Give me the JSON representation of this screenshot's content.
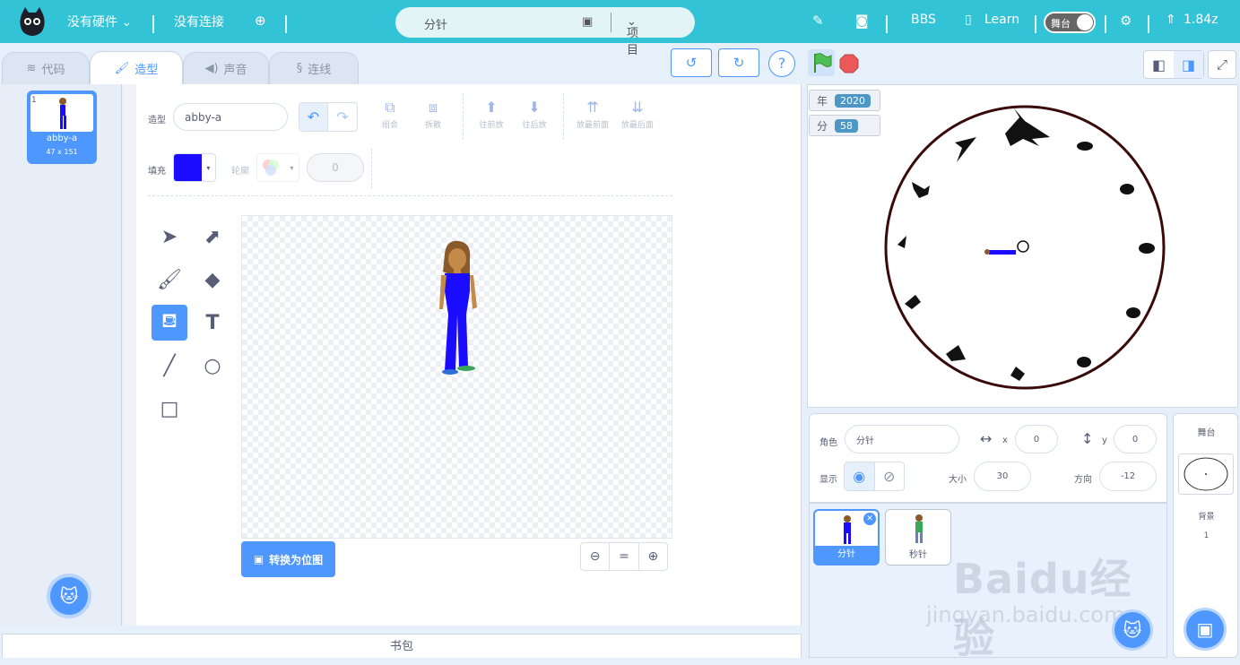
{
  "topbar": {
    "hardware": "没有硬件",
    "connection": "没有连接",
    "project_name": "分针",
    "project_menu": "项目",
    "bbs": "BBS",
    "learn": "Learn",
    "stage_toggle": "舞台",
    "version": "1.84z"
  },
  "tabs": {
    "code": "代码",
    "costume": "造型",
    "sound": "声音",
    "wire": "连线"
  },
  "costume_list": {
    "number": "1",
    "name": "abby-a",
    "size": "47 x 151"
  },
  "editor": {
    "costume_label": "造型",
    "costume_name": "abby-a",
    "fill_label": "填充",
    "outline_label": "轮廓",
    "outline_width": "0",
    "fill_color": "#1a0dff",
    "buttons": {
      "group": "组合",
      "ungroup": "拆散",
      "forward": "往前放",
      "backward": "往后放",
      "front": "放最前面",
      "back": "放最后面"
    },
    "convert_bitmap": "转换为位图"
  },
  "stage": {
    "monitors": [
      {
        "label": "年",
        "value": "2020"
      },
      {
        "label": "分",
        "value": "58"
      }
    ]
  },
  "sprite": {
    "role_label": "角色",
    "name": "分针",
    "x_label": "x",
    "x": "0",
    "y_label": "y",
    "y": "0",
    "show_label": "显示",
    "size_label": "大小",
    "size": "30",
    "direction_label": "方向",
    "direction": "-12"
  },
  "sprites": [
    {
      "name": "分针"
    },
    {
      "name": "秒针"
    }
  ],
  "stage_panel": {
    "title": "舞台",
    "backdrop_label": "背景",
    "backdrop_count": "1"
  },
  "backpack": "书包",
  "watermark": {
    "logo": "Baidu经验",
    "url": "jingyan.baidu.com"
  }
}
